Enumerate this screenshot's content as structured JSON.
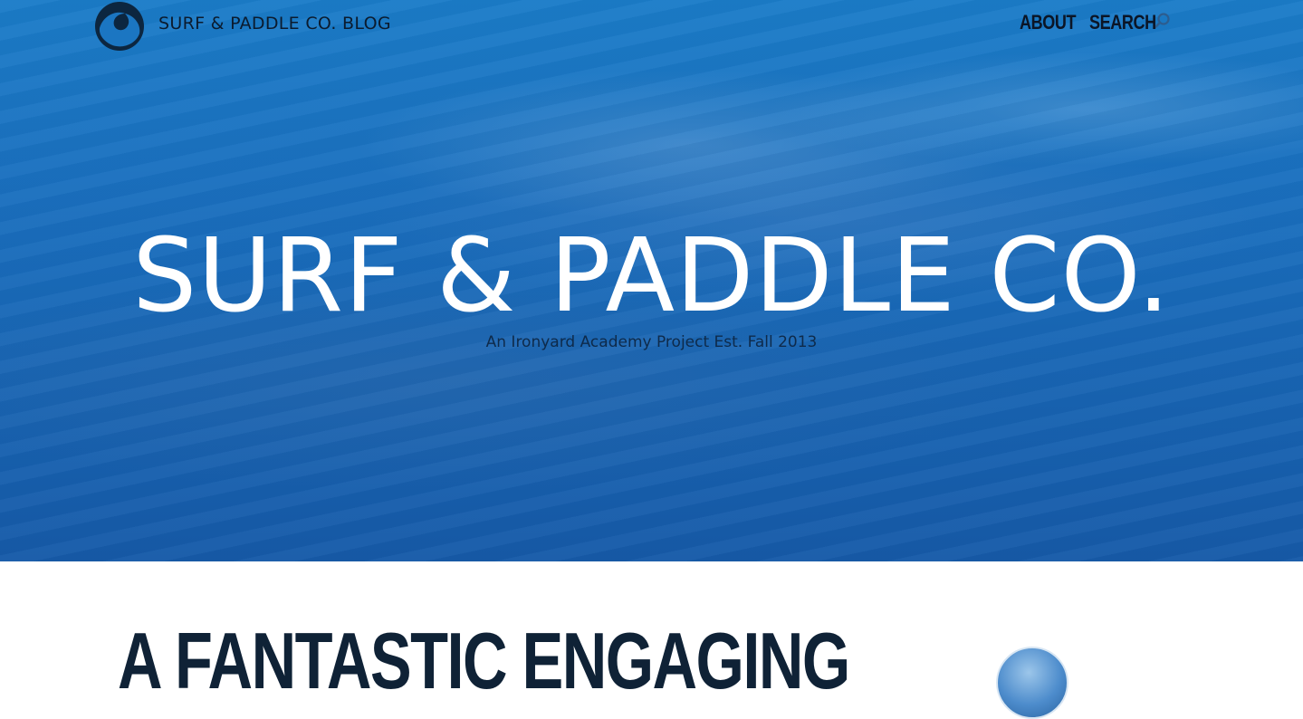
{
  "header": {
    "logo_icon": "wave-logo-icon",
    "site_title": "SURF & PADDLE CO. BLOG",
    "nav": {
      "about_label": "ABOUT",
      "search_label": "SEARCH",
      "search_icon": "search-icon"
    }
  },
  "hero": {
    "title": "SURF & PADDLE CO.",
    "subtitle": "An Ironyard Academy Project Est. Fall 2013"
  },
  "post": {
    "heading": "A FANTASTIC ENGAGING"
  },
  "colors": {
    "hero_blue": "#1a6fbe",
    "title_text": "#ffffff",
    "nav_text": "#0b1526",
    "heading_text": "#0f2236"
  }
}
